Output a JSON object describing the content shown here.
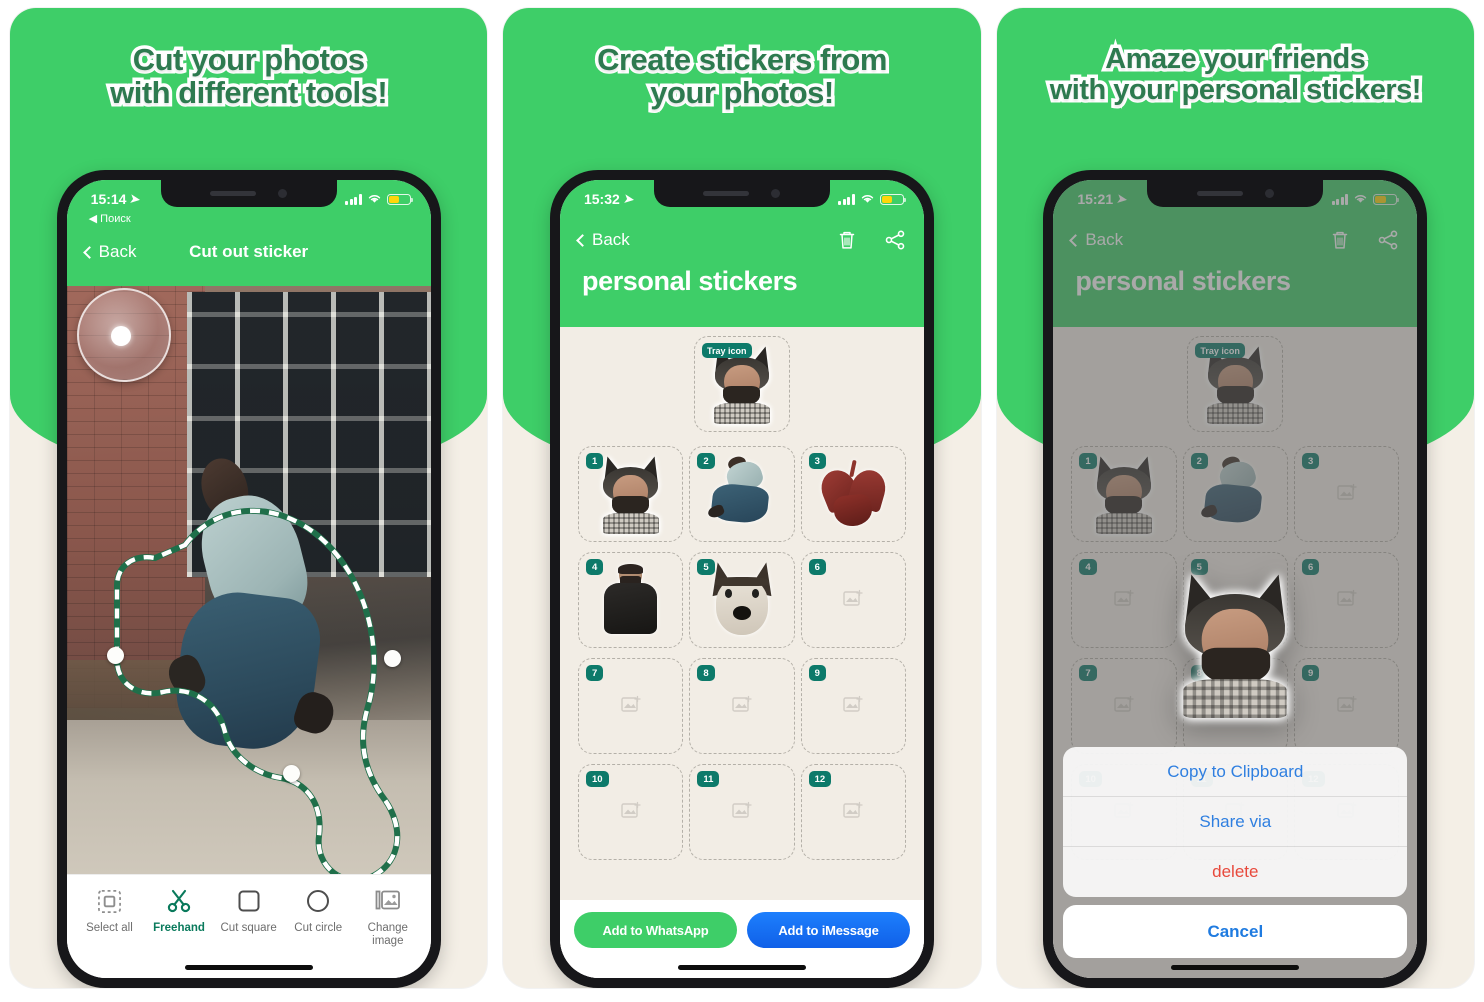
{
  "panels": [
    {
      "headline": {
        "line1": "Cut your photos",
        "line2": "with different tools!"
      },
      "status": {
        "time": "15:14",
        "location_icon": "location-arrow-icon",
        "back_app": "◀ Поиск",
        "battery": "battery-low-power-icon"
      },
      "nav": {
        "back_label": "Back",
        "title": "Cut out sticker"
      },
      "toolbar": [
        {
          "label": "Select all",
          "icon": "dashed-square-icon",
          "active": false
        },
        {
          "label": "Freehand",
          "icon": "scissors-icon",
          "active": true
        },
        {
          "label": "Cut square",
          "icon": "square-icon",
          "active": false
        },
        {
          "label": "Cut circle",
          "icon": "circle-icon",
          "active": false
        },
        {
          "label": "Change image",
          "icon": "photo-stack-icon",
          "active": false
        }
      ]
    },
    {
      "headline": {
        "line1": "Create stickers from",
        "line2": "your photos!"
      },
      "status": {
        "time": "15:32",
        "location_icon": "location-arrow-icon",
        "battery": "battery-low-power-icon"
      },
      "nav": {
        "back_label": "Back",
        "title": "personal stickers",
        "actions": [
          "trash-icon",
          "share-icon"
        ]
      },
      "tray": {
        "badge": "Tray icon",
        "art": "wolf"
      },
      "slots": [
        {
          "num": "1",
          "art": "wolf"
        },
        {
          "num": "2",
          "art": "jump"
        },
        {
          "num": "3",
          "art": "heart"
        },
        {
          "num": "4",
          "art": "tee"
        },
        {
          "num": "5",
          "art": "dog"
        },
        {
          "num": "6",
          "art": "empty"
        },
        {
          "num": "7",
          "art": "empty"
        },
        {
          "num": "8",
          "art": "empty"
        },
        {
          "num": "9",
          "art": "empty"
        },
        {
          "num": "10",
          "art": "empty"
        },
        {
          "num": "11",
          "art": "empty"
        },
        {
          "num": "12",
          "art": "empty"
        }
      ],
      "buttons": {
        "whatsapp": "Add to WhatsApp",
        "imessage": "Add to iMessage"
      }
    },
    {
      "headline": {
        "line1": "Amaze your friends",
        "line2": "with your personal stickers!"
      },
      "status": {
        "time": "15:21",
        "location_icon": "location-arrow-icon",
        "battery": "battery-low-power-icon"
      },
      "nav": {
        "back_label": "Back",
        "title": "personal stickers",
        "actions": [
          "trash-icon",
          "share-icon"
        ]
      },
      "tray": {
        "badge": "Tray icon",
        "art": "wolf"
      },
      "slots": [
        {
          "num": "1",
          "art": "wolf"
        },
        {
          "num": "2",
          "art": "jump"
        },
        {
          "num": "3",
          "art": "empty"
        },
        {
          "num": "4",
          "art": "empty"
        },
        {
          "num": "5",
          "art": "empty"
        },
        {
          "num": "6",
          "art": "empty"
        },
        {
          "num": "7",
          "art": "empty"
        },
        {
          "num": "8",
          "art": "empty"
        },
        {
          "num": "9",
          "art": "empty"
        },
        {
          "num": "10",
          "art": "empty"
        },
        {
          "num": "11",
          "art": "empty"
        },
        {
          "num": "12",
          "art": "empty"
        }
      ],
      "action_sheet": {
        "items": [
          {
            "label": "Copy to Clipboard",
            "style": "default"
          },
          {
            "label": "Share via",
            "style": "default"
          },
          {
            "label": "delete",
            "style": "destructive"
          }
        ],
        "cancel": "Cancel"
      }
    }
  ],
  "colors": {
    "brand_green": "#3ece68",
    "headline_green": "#2d7a4f",
    "badge_teal": "#0d7a6a",
    "imessage_blue": "#1d7ffd",
    "destructive_red": "#e8493c",
    "panel_cream": "#f4efe6",
    "sticker_bg": "#f2ede5"
  }
}
